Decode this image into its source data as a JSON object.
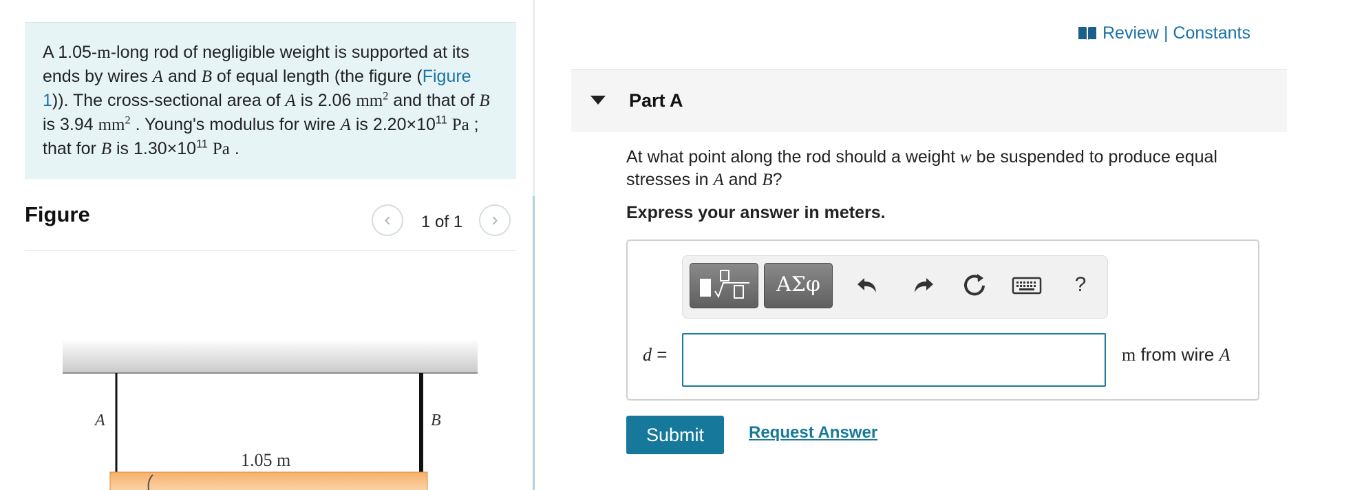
{
  "problem": {
    "intro": "A 1.05-",
    "unit_m": "m",
    "text1": "-long rod of negligible weight is supported at its ends by wires ",
    "var_a": "A",
    "text2": " and ",
    "var_b": "B",
    "text3": " of equal length (the figure (",
    "figure_link": "Figure 1",
    "text4": ")). The cross-sectional area of ",
    "text5": " is 2.06 ",
    "area_unit": "mm",
    "area_exp": "2",
    "text6": " and that of ",
    "text7": " is 3.94 ",
    "text8": " . Young's modulus for wire ",
    "text9": " is 2.20×10",
    "exp11": "11",
    "pa": "Pa",
    "text10": " ; that for ",
    "text11": " is 1.30×10",
    "text12": " ."
  },
  "figure": {
    "heading": "Figure",
    "count": "1 of 1",
    "prev": "‹",
    "next": "›",
    "label_a": "A",
    "label_b": "B",
    "length_label": "1.05 m"
  },
  "header": {
    "review": "Review",
    "separator": "|",
    "constants": "Constants"
  },
  "part": {
    "title": "Part A",
    "question_1": "At what point along the rod should a weight ",
    "var_w": "w",
    "question_2": " be suspended to produce equal stresses in ",
    "question_3": " and ",
    "question_4": "?",
    "instruction": "Express your answer in meters."
  },
  "answer": {
    "var_label": "d",
    "equals": " =",
    "input_value": "",
    "unit_m": "m",
    "unit_text": " from wire ",
    "unit_var": "A",
    "greek": "ΑΣφ",
    "help": "?"
  },
  "actions": {
    "submit": "Submit",
    "request_answer": "Request Answer"
  }
}
